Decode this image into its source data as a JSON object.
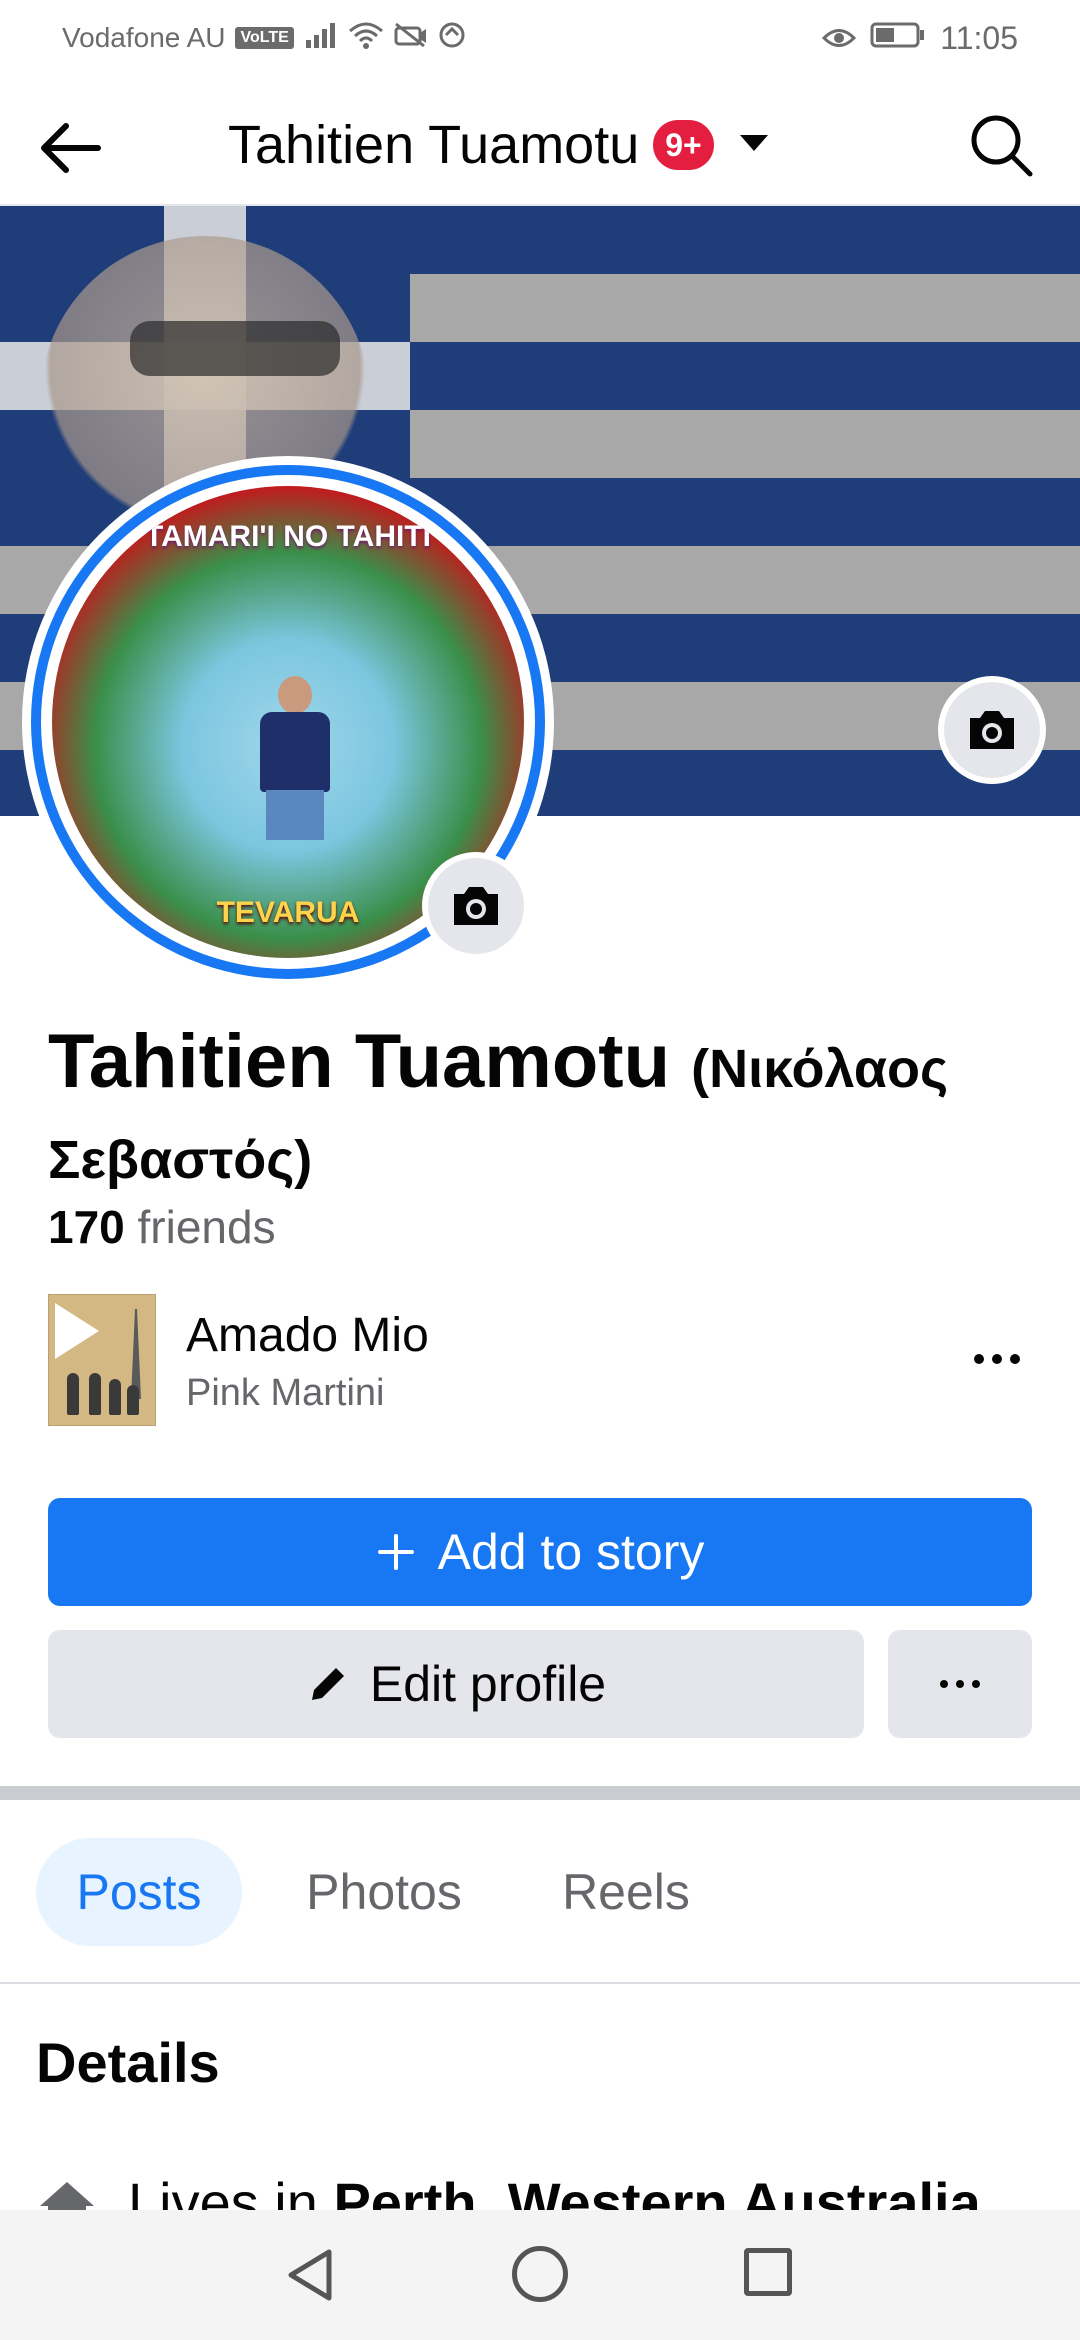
{
  "status_bar": {
    "carrier": "Vodafone AU",
    "volte": "VoLTE",
    "time": "11:05"
  },
  "app_bar": {
    "title": "Tahitien Tuamotu",
    "notification_badge": "9+"
  },
  "cover": {
    "flag_colors": {
      "blue": "#1f3e79",
      "white": "#e8e8e8"
    }
  },
  "profile_picture": {
    "top_text": "TAMARI'I NO TAHITI",
    "bottom_text": "TEVARUA"
  },
  "profile": {
    "name": "Tahitien Tuamotu",
    "alternate_name": "(Νικόλαος Σεβαστός)",
    "friends_count": "170",
    "friends_label": "friends"
  },
  "music": {
    "song": "Amado Mio",
    "artist": "Pink Martini"
  },
  "actions": {
    "add_to_story": "Add to story",
    "edit_profile": "Edit profile"
  },
  "tabs": [
    {
      "label": "Posts",
      "active": true
    },
    {
      "label": "Photos",
      "active": false
    },
    {
      "label": "Reels",
      "active": false
    }
  ],
  "details": {
    "title": "Details",
    "lives_prefix": "Lives in ",
    "lives_place": "Perth, Western Australia"
  },
  "colors": {
    "accent": "#1877f2",
    "badge": "#e41e3f",
    "button_gray": "#e4e6eb",
    "text_secondary": "#65676b"
  }
}
